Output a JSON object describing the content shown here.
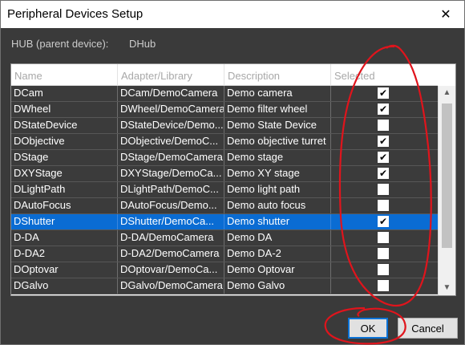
{
  "window": {
    "title": "Peripheral Devices Setup",
    "close_glyph": "✕"
  },
  "hub": {
    "label": "HUB (parent device):",
    "value": "DHub"
  },
  "table": {
    "headers": [
      "Name",
      "Adapter/Library",
      "Description",
      "Selected"
    ],
    "rows": [
      {
        "name": "DCam",
        "adapter": "DCam/DemoCamera",
        "description": "Demo camera",
        "checked": true,
        "mark": "✔"
      },
      {
        "name": "DWheel",
        "adapter": "DWheel/DemoCamera",
        "description": "Demo filter wheel",
        "checked": true,
        "mark": "✔"
      },
      {
        "name": "DStateDevice",
        "adapter": "DStateDevice/Demo...",
        "description": "Demo State Device",
        "checked": false,
        "mark": ""
      },
      {
        "name": "DObjective",
        "adapter": "DObjective/DemoC...",
        "description": "Demo objective turret",
        "checked": true,
        "mark": "✔"
      },
      {
        "name": "DStage",
        "adapter": "DStage/DemoCamera",
        "description": "Demo stage",
        "checked": true,
        "mark": "✔"
      },
      {
        "name": "DXYStage",
        "adapter": "DXYStage/DemoCa...",
        "description": "Demo XY stage",
        "checked": true,
        "mark": "✔"
      },
      {
        "name": "DLightPath",
        "adapter": "DLightPath/DemoC...",
        "description": "Demo light path",
        "checked": false,
        "mark": ""
      },
      {
        "name": "DAutoFocus",
        "adapter": "DAutoFocus/Demo...",
        "description": "Demo auto focus",
        "checked": false,
        "mark": ""
      },
      {
        "name": "DShutter",
        "adapter": "DShutter/DemoCa...",
        "description": "Demo shutter",
        "checked": true,
        "mark": "✔",
        "selected": true
      },
      {
        "name": "D-DA",
        "adapter": "D-DA/DemoCamera",
        "description": "Demo DA",
        "checked": false,
        "mark": ""
      },
      {
        "name": "D-DA2",
        "adapter": "D-DA2/DemoCamera",
        "description": "Demo DA-2",
        "checked": false,
        "mark": ""
      },
      {
        "name": "DOptovar",
        "adapter": "DOptovar/DemoCa...",
        "description": "Demo Optovar",
        "checked": false,
        "mark": ""
      },
      {
        "name": "DGalvo",
        "adapter": "DGalvo/DemoCamera",
        "description": "Demo Galvo",
        "checked": false,
        "mark": ""
      }
    ]
  },
  "scrollbar": {
    "up_icon": "chevron-up-icon",
    "down_icon": "chevron-down-icon",
    "up_glyph": "▲",
    "down_glyph": "▼"
  },
  "buttons": {
    "ok": "OK",
    "cancel": "Cancel"
  },
  "colors": {
    "background": "#3a3a3a",
    "selected_row": "#0a6cd3",
    "annotation": "#e0141c"
  }
}
